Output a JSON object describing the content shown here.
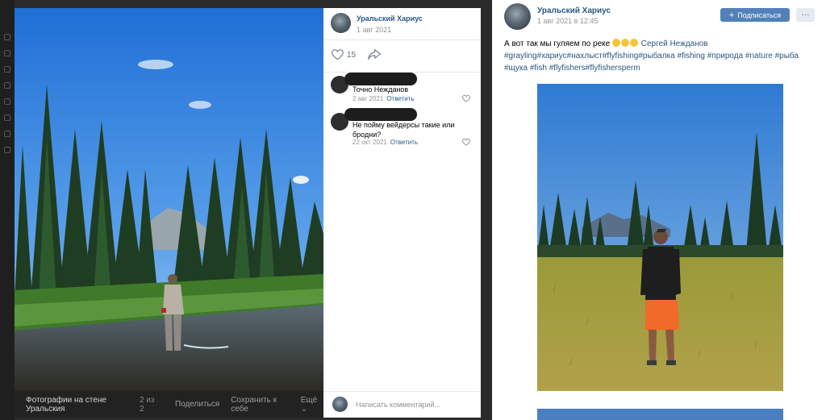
{
  "viewer": {
    "bottom_bar": {
      "album": "Фотографии на стене Уральския",
      "counter": "2 из 2",
      "share": "Поделиться",
      "save": "Сохранить к себе",
      "more": "Ещё ⌄"
    },
    "panel": {
      "author": "Уральский Хариус",
      "date": "1 авг 2021",
      "likes": "15",
      "comments": [
        {
          "text": "Точно Нежданов",
          "date": "2 авг 2021",
          "reply": "Ответить"
        },
        {
          "text": "Не пойму вейдерсы такие или бродни?",
          "date": "22 окт 2021",
          "reply": "Ответить"
        }
      ],
      "comment_placeholder": "Написать комментарий..."
    }
  },
  "post": {
    "author": "Уральский Хариус",
    "date": "1 авг 2021 в 12:45",
    "subscribe": "Подписаться",
    "more": "···",
    "text": "А вот так мы гуляем по реке",
    "mention": "Сергей Нежданов",
    "hashtags": "#grayling#хариус#нахлыст#flyfishing#рыбалка #fishing #природа #nature #рыба #щука #fish #flyfishers#flyfishersperm"
  },
  "colors": {
    "link": "#2a5885",
    "button": "#5181b8",
    "muted": "#939393"
  }
}
